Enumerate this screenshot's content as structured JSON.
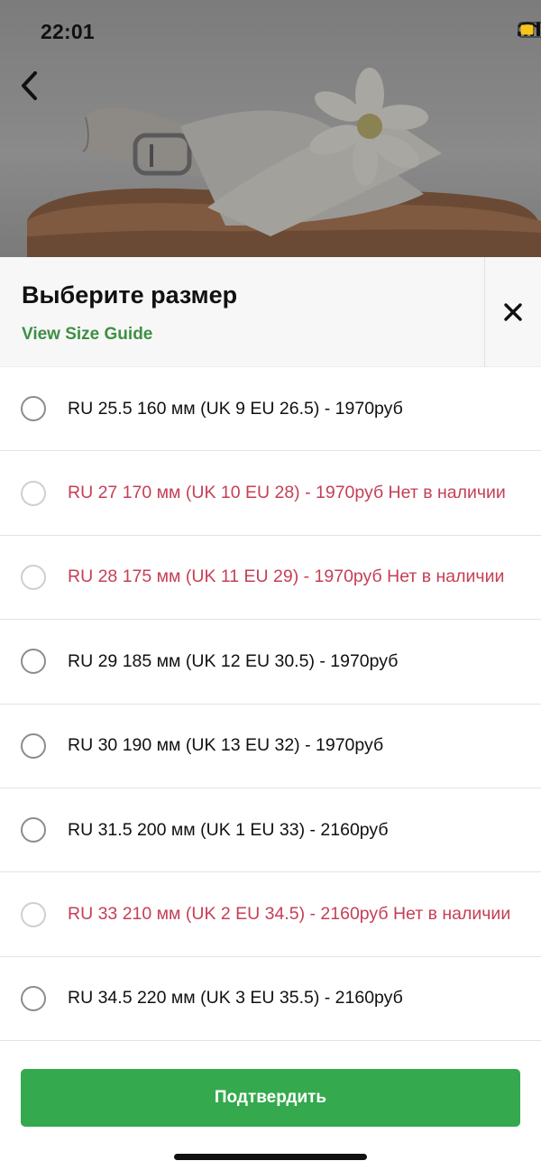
{
  "status_bar": {
    "time": "22:01",
    "icons": [
      "cellular-signal-icon",
      "wifi-icon",
      "battery-icon"
    ],
    "battery_color": "#f5c518"
  },
  "nav": {
    "back_icon": "chevron-left-icon"
  },
  "product_image": {
    "subject": "white children's sandal with daisy flower"
  },
  "sheet": {
    "title": "Выберите размер",
    "size_guide_label": "View Size Guide",
    "close_icon": "close-icon"
  },
  "sizes": [
    {
      "label": "RU 25.5 160 мм (UK 9 EU 26.5) - 1970руб",
      "available": true,
      "selected": false
    },
    {
      "label": "RU 27 170 мм (UK 10 EU 28) - 1970руб Нет в наличии",
      "available": false,
      "selected": false
    },
    {
      "label": "RU 28 175 мм (UK 11 EU 29) - 1970руб Нет в наличии",
      "available": false,
      "selected": false
    },
    {
      "label": "RU 29 185 мм (UK 12 EU 30.5) - 1970руб",
      "available": true,
      "selected": false
    },
    {
      "label": "RU 30 190 мм (UK 13 EU 32) - 1970руб",
      "available": true,
      "selected": false
    },
    {
      "label": "RU 31.5 200 мм (UK 1 EU 33) - 2160руб",
      "available": true,
      "selected": false
    },
    {
      "label": "RU 33 210 мм (UK 2 EU 34.5) - 2160руб Нет в наличии",
      "available": false,
      "selected": false
    },
    {
      "label": "RU 34.5 220 мм (UK 3 EU 35.5) - 2160руб",
      "available": true,
      "selected": false
    }
  ],
  "footer": {
    "confirm_label": "Подтвердить"
  },
  "colors": {
    "accent_green": "#34a94d",
    "link_green": "#3d8f45",
    "unavailable_red": "#c53f55"
  }
}
